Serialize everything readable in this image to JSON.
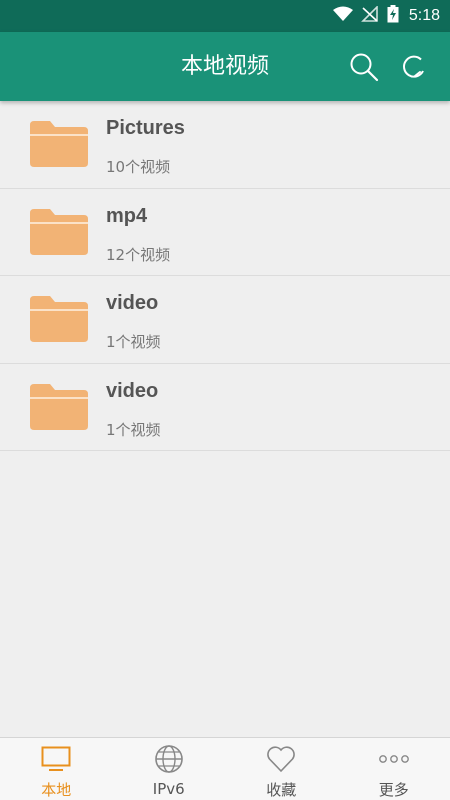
{
  "status_bar": {
    "time": "5:18"
  },
  "app_bar": {
    "title": "本地视频"
  },
  "folders": [
    {
      "name": "Pictures",
      "count": "10个视频"
    },
    {
      "name": "mp4",
      "count": "12个视频"
    },
    {
      "name": "video",
      "count": "1个视频"
    },
    {
      "name": "video",
      "count": "1个视频"
    }
  ],
  "bottom_nav": {
    "items": [
      {
        "label": "本地",
        "icon": "tv-icon",
        "active": true
      },
      {
        "label": "IPv6",
        "icon": "globe-icon",
        "active": false
      },
      {
        "label": "收藏",
        "icon": "heart-icon",
        "active": false
      },
      {
        "label": "更多",
        "icon": "more-dots-icon",
        "active": false
      }
    ]
  },
  "colors": {
    "status_bar": "#0f6b58",
    "app_bar": "#1a9278",
    "folder": "#f2b375",
    "active_tab": "#e8901e"
  }
}
